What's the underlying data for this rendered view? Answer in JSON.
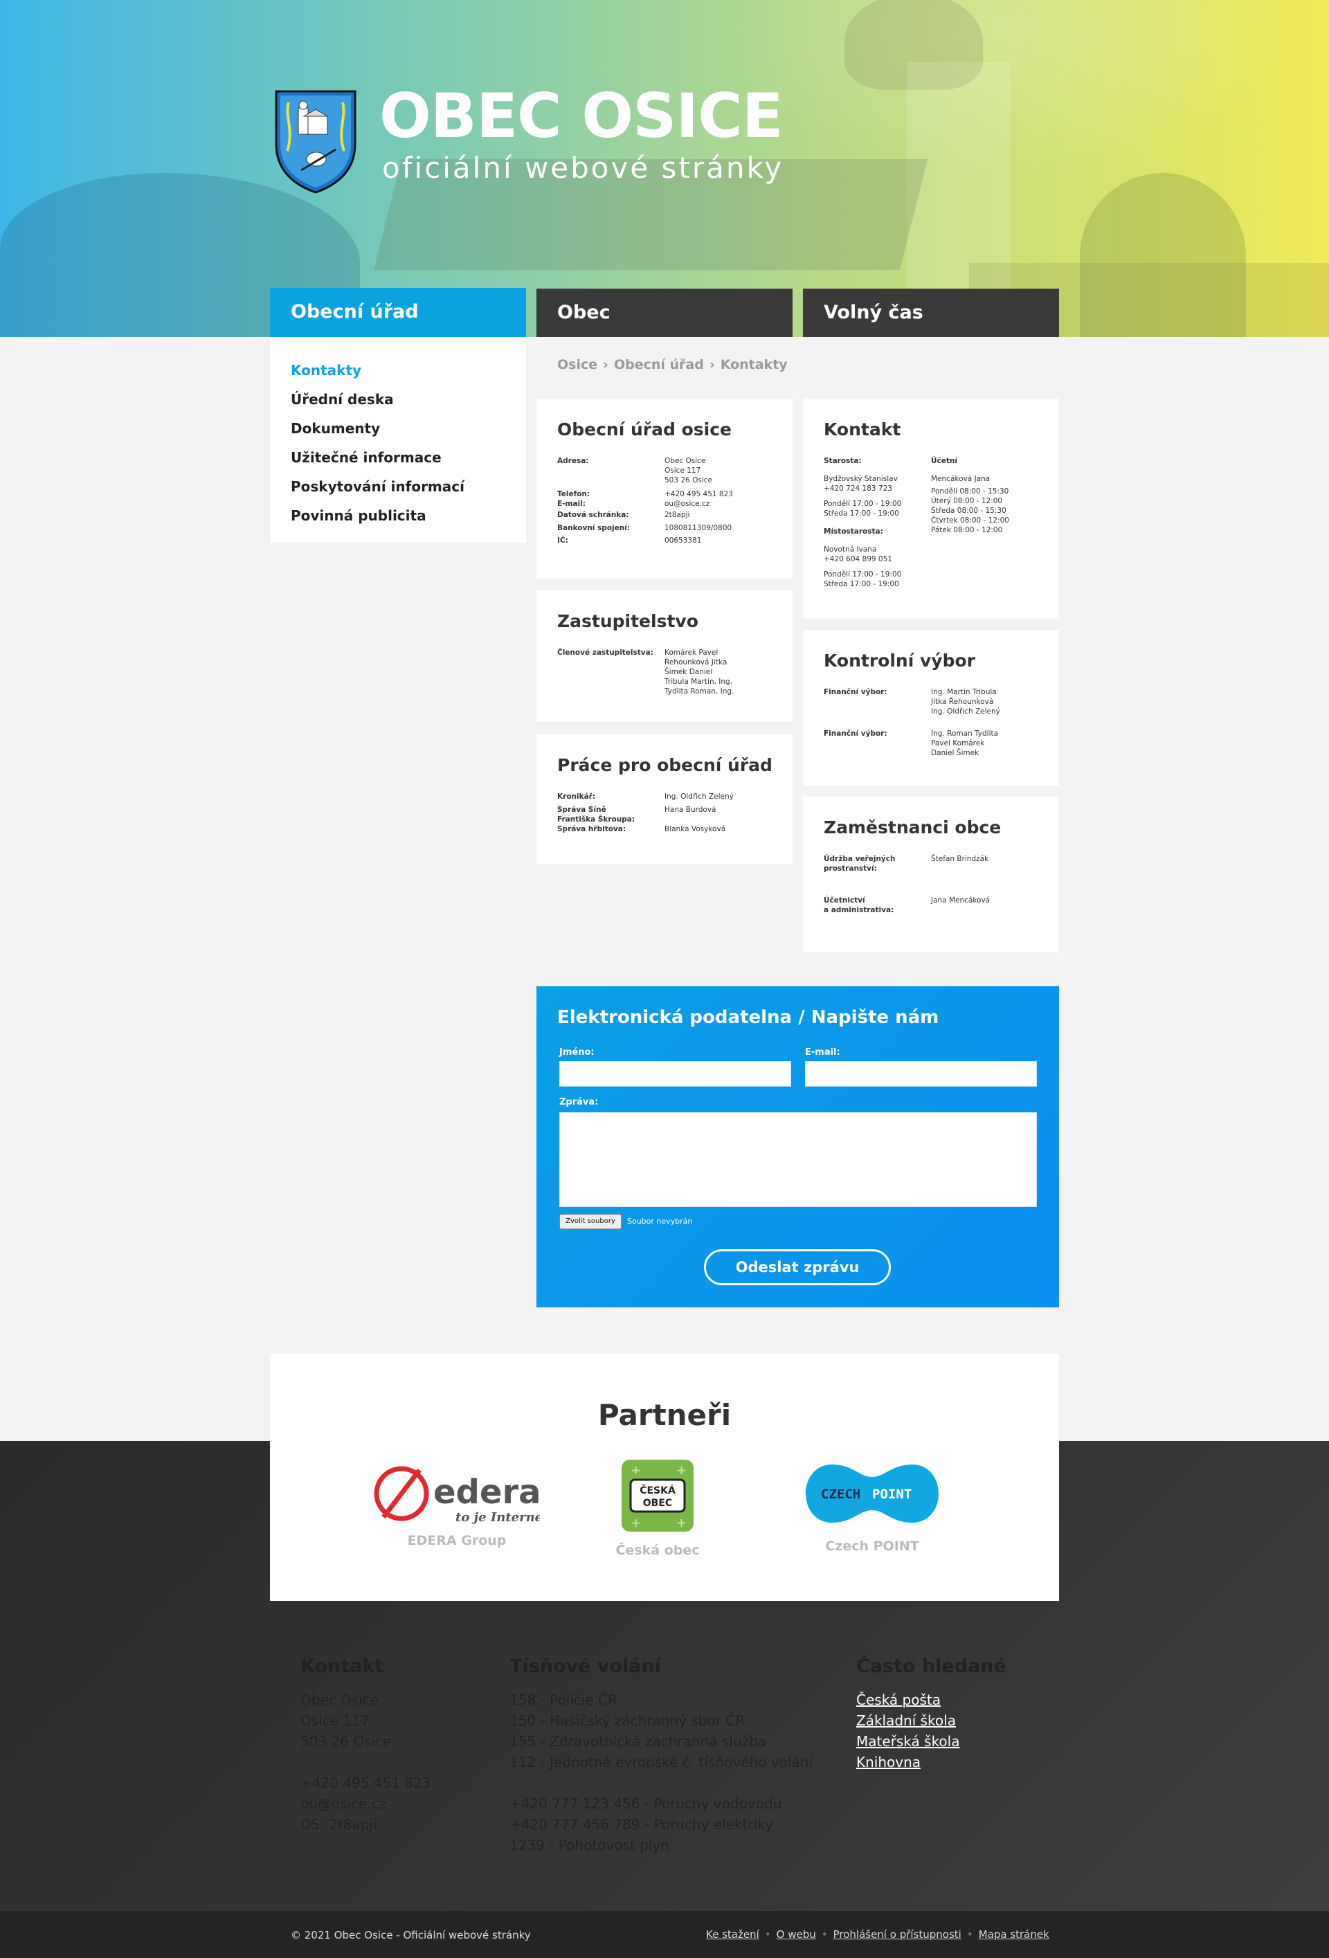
{
  "header": {
    "title": "OBEC OSICE",
    "subtitle": "oficiální webové stránky"
  },
  "nav": {
    "tabs": [
      "Obecní úřad",
      "Obec",
      "Volný čas"
    ]
  },
  "sidebar": {
    "items": [
      "Kontakty",
      "Úřední deska",
      "Dokumenty",
      "Užitečné informace",
      "Poskytování informací",
      "Povinná publicita"
    ]
  },
  "breadcrumb": [
    "Osice",
    "Obecní úřad",
    "Kontakty"
  ],
  "office": {
    "title": "Obecní úřad osice",
    "address_label": "Adresa:",
    "address": [
      "Obec Osice",
      "Osice 117",
      "503 26 Osice"
    ],
    "phone_label": "Telefon:",
    "phone": "+420 495 451 823",
    "email_label": "E-mail:",
    "email": "ou@osice.cz",
    "ds_label": "Datová schránka:",
    "ds": "2t8apji",
    "bank_label": "Bankovní spojení:",
    "bank": "1080811309/0800",
    "ic_label": "IČ:",
    "ic": "00653381"
  },
  "council": {
    "title": "Zastupitelstvo",
    "label": "Členové zastupitelstva:",
    "members": [
      "Komárek Pavel",
      "Řehounková Jitka",
      "Šimek Daniel",
      "Tribula Martin, Ing.",
      "Tydlita Roman, Ing."
    ]
  },
  "work": {
    "title": "Práce pro obecní úřad",
    "r1_label": "Kronikář:",
    "r1_value": "Ing. Oldřich Zelený",
    "r2_label_a": "Správa Síně",
    "r2_label_b": "Františka Škroupa:",
    "r2_value": "Hana Burdová",
    "r3_label": "Správa hřbitova:",
    "r3_value": "Blanka Vosyková"
  },
  "contact": {
    "title": "Kontakt",
    "starosta_label": "Starosta:",
    "starosta": [
      "Bydžovský Stanislav",
      "+420 724 183 723"
    ],
    "starosta_hours": [
      "Pondělí 17:00 - 19:00",
      "Středa 17:00 - 19:00"
    ],
    "mistostarosta_label": "Místostarosta:",
    "mistostarosta": [
      "Novotná Ivana",
      "+420 604 899 051"
    ],
    "mistostarosta_hours": [
      "Pondělí 17:00 - 19:00",
      "Středa 17:00 - 19:00"
    ],
    "ucetni_label": "Účetní",
    "ucetni": "Mencáková Jana",
    "ucetni_hours": [
      "Pondělí 08:00 - 15:30",
      "Úterý 08:00 - 12:00",
      "Středa 08:00 - 15:30",
      "Čtvrtek 08:00 - 12:00",
      "Pátek 08:00 - 12:00"
    ]
  },
  "control": {
    "title": "Kontrolní výbor",
    "g1_label": "Finanční výbor:",
    "g1": [
      "Ing. Martin Tribula",
      "Jitka Řehounková",
      "Ing. Oldřich Zelený"
    ],
    "g2_label": "Finanční výbor:",
    "g2": [
      "Ing. Roman Tydlita",
      "Pavel Komárek",
      "Daniel Šimek"
    ]
  },
  "staff": {
    "title": "Zaměstnanci obce",
    "r1_label_a": "Údržba veřejných",
    "r1_label_b": "prostranství:",
    "r1_value": "Štefan Brindzák",
    "r2_label_a": "Účetnictví",
    "r2_label_b": "a administrativa:",
    "r2_value": "Jana Mencáková"
  },
  "form": {
    "title": "Elektronická podatelna / Napište nám",
    "name_label": "Jméno:",
    "email_label": "E-mail:",
    "message_label": "Zpráva:",
    "file_button": "Zvolit soubory",
    "file_status": "Soubor nevybrán",
    "submit": "Odeslat zprávu"
  },
  "partners": {
    "title": "Partneři",
    "items": [
      {
        "name": "EDERA Group",
        "logo_text": "edera",
        "logo_tagline": "to je Internet"
      },
      {
        "name": "Česká obec",
        "logo_text": "ČESKÁ",
        "logo_text2": "OBEC"
      },
      {
        "name": "Czech POINT",
        "logo_text": "CZECH",
        "logo_text2": "POINT"
      }
    ]
  },
  "footer": {
    "contact": {
      "title": "Kontakt",
      "lines": [
        "Obec Osice",
        "Osice 117",
        "503 26 Osice"
      ],
      "lines2": [
        "+420 495 451 823",
        "ou@osice.cz",
        "DS: 2t8apji"
      ]
    },
    "emergency": {
      "title": "Tísňové volání",
      "lines": [
        "158 - Policie ČR",
        "150 - Hasičský záchranný sbor ČR",
        "155 - Zdravotnická záchranná služba",
        "112 - Jednotné evropské č. tísňového volání"
      ],
      "lines2": [
        "+420 777 123 456 - Poruchy vodovodu",
        "+420 777 456 789 - Poruchy elektriky",
        "1239 - Pohotovost plyn"
      ]
    },
    "frequent": {
      "title": "Často hledané",
      "links": [
        "Česká pošta",
        "Základní škola",
        "Mateřská škola",
        "Knihovna"
      ]
    }
  },
  "bottom": {
    "copyright": "© 2021 Obec Osice - Oficiální webové stránky",
    "links": [
      "Ke stažení",
      "O webu",
      "Prohlášení o přístupnosti",
      "Mapa stránek"
    ]
  },
  "colors": {
    "accent": "#0ca2e2",
    "dark": "#3a3a3a"
  }
}
